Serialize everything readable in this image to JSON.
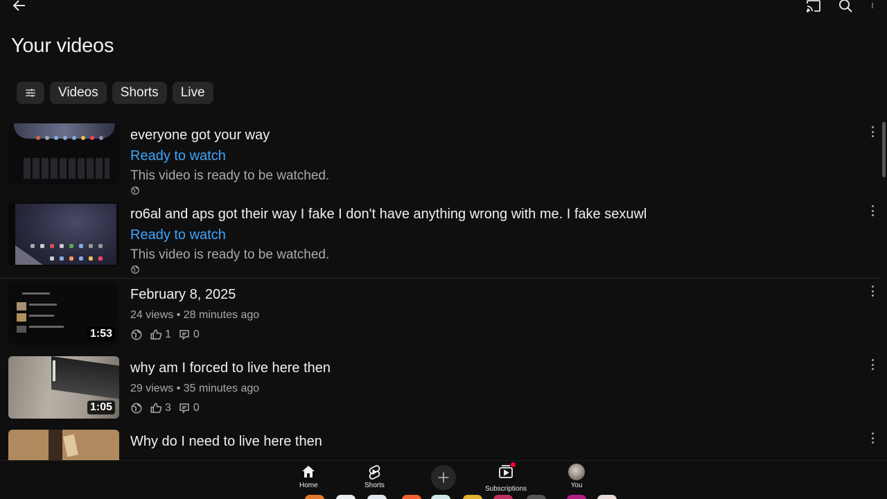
{
  "header": {
    "title": "Your videos",
    "icons": [
      "back-arrow-icon",
      "cast-icon",
      "search-icon",
      "more-vert-icon"
    ]
  },
  "filters": {
    "filter_icon": "filter-sliders-icon",
    "chips": [
      "Videos",
      "Shorts",
      "Live"
    ]
  },
  "videos": [
    {
      "title": "everyone got your way",
      "status": "Ready to watch",
      "description": "This video is ready to be watched.",
      "visibility_icon": "globe-icon"
    },
    {
      "title": "ro6al and aps got their way I fake I don't have anything wrong with me. I fake sexuwl",
      "status": "Ready to watch",
      "description": "This video is ready to be watched.",
      "visibility_icon": "globe-icon"
    },
    {
      "title": "February 8, 2025",
      "duration": "1:53",
      "meta": "24 views • 28 minutes ago",
      "likes": "1",
      "comments": "0"
    },
    {
      "title": "why am I forced to live here then",
      "duration": "1:05",
      "meta": "29 views • 35 minutes ago",
      "likes": "3",
      "comments": "0"
    },
    {
      "title": "Why do I need to live here then"
    }
  ],
  "bottom_nav": {
    "items": [
      {
        "label": "Home",
        "icon": "home-icon"
      },
      {
        "label": "Shorts",
        "icon": "shorts-icon"
      },
      {
        "label": "",
        "icon": "plus-icon"
      },
      {
        "label": "Subscriptions",
        "icon": "subscriptions-icon"
      },
      {
        "label": "You",
        "icon": "avatar"
      }
    ]
  },
  "colors": {
    "background": "#0f0f0f",
    "chip": "#272727",
    "status_blue": "#3ea6ff",
    "secondary_text": "#aaaaaa",
    "notification_dot": "#ff0033"
  }
}
